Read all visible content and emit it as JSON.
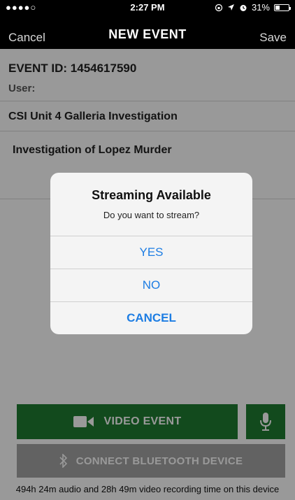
{
  "status_bar": {
    "signal": "●●●●○",
    "time": "2:27 PM",
    "battery": "31%"
  },
  "nav": {
    "cancel_label": "Cancel",
    "title": "NEW EVENT",
    "save_label": "Save"
  },
  "event": {
    "id_label": "EVENT ID: 1454617590",
    "user_label": "User:",
    "case_name": "CSI Unit 4 Galleria Investigation",
    "description": "Investigation of Lopez Murder"
  },
  "alert": {
    "title": "Streaming Available",
    "message": "Do you want to stream?",
    "yes_label": "YES",
    "no_label": "NO",
    "cancel_label": "CANCEL"
  },
  "bottom": {
    "video_label": "VIDEO EVENT",
    "bluetooth_label": "CONNECT BLUETOOTH DEVICE",
    "recording_info": "494h 24m audio and 28h 49m video recording time on this device"
  },
  "colors": {
    "accent_green": "#1e7c31",
    "alert_blue": "#1d7de3",
    "disabled_gray": "#a3a3a3"
  }
}
